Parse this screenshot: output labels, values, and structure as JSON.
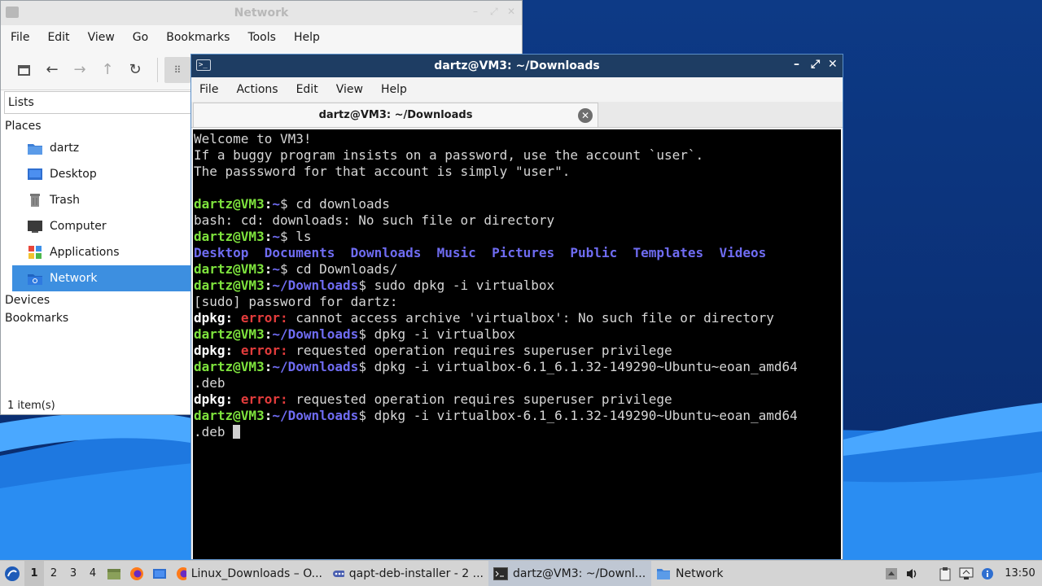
{
  "file_manager": {
    "title": "Network",
    "menu": [
      "File",
      "Edit",
      "View",
      "Go",
      "Bookmarks",
      "Tools",
      "Help"
    ],
    "lists_label": "Lists",
    "places_header": "Places",
    "places": [
      {
        "label": "dartz",
        "icon": "home-folder-icon"
      },
      {
        "label": "Desktop",
        "icon": "desktop-icon"
      },
      {
        "label": "Trash",
        "icon": "trash-icon"
      },
      {
        "label": "Computer",
        "icon": "computer-icon"
      },
      {
        "label": "Applications",
        "icon": "applications-icon"
      },
      {
        "label": "Network",
        "icon": "network-icon",
        "selected": true
      }
    ],
    "devices_header": "Devices",
    "bookmarks_header": "Bookmarks",
    "status": "1 item(s)"
  },
  "terminal": {
    "title": "dartz@VM3: ~/Downloads",
    "menu": [
      "File",
      "Actions",
      "Edit",
      "View",
      "Help"
    ],
    "tab_label": "dartz@VM3: ~/Downloads",
    "lines": [
      [
        {
          "t": "Welcome to VM3!",
          "c": ""
        }
      ],
      [
        {
          "t": "If a buggy program insists on a password, use the account `user`.",
          "c": ""
        }
      ],
      [
        {
          "t": "The passsword for that account is simply \"user\".",
          "c": ""
        }
      ],
      [
        {
          "t": "",
          "c": ""
        }
      ],
      [
        {
          "t": "dartz@VM3",
          "c": "g"
        },
        {
          "t": ":",
          "c": "w"
        },
        {
          "t": "~",
          "c": "b"
        },
        {
          "t": "$ cd downloads",
          "c": ""
        }
      ],
      [
        {
          "t": "bash: cd: downloads: No such file or directory",
          "c": ""
        }
      ],
      [
        {
          "t": "dartz@VM3",
          "c": "g"
        },
        {
          "t": ":",
          "c": "w"
        },
        {
          "t": "~",
          "c": "b"
        },
        {
          "t": "$ ls",
          "c": ""
        }
      ],
      [
        {
          "t": "Desktop",
          "c": "b"
        },
        {
          "t": "  ",
          "c": ""
        },
        {
          "t": "Documents",
          "c": "b"
        },
        {
          "t": "  ",
          "c": ""
        },
        {
          "t": "Downloads",
          "c": "b"
        },
        {
          "t": "  ",
          "c": ""
        },
        {
          "t": "Music",
          "c": "b"
        },
        {
          "t": "  ",
          "c": ""
        },
        {
          "t": "Pictures",
          "c": "b"
        },
        {
          "t": "  ",
          "c": ""
        },
        {
          "t": "Public",
          "c": "b"
        },
        {
          "t": "  ",
          "c": ""
        },
        {
          "t": "Templates",
          "c": "b"
        },
        {
          "t": "  ",
          "c": ""
        },
        {
          "t": "Videos",
          "c": "b"
        }
      ],
      [
        {
          "t": "dartz@VM3",
          "c": "g"
        },
        {
          "t": ":",
          "c": "w"
        },
        {
          "t": "~",
          "c": "b"
        },
        {
          "t": "$ cd Downloads/",
          "c": ""
        }
      ],
      [
        {
          "t": "dartz@VM3",
          "c": "g"
        },
        {
          "t": ":",
          "c": "w"
        },
        {
          "t": "~/Downloads",
          "c": "b"
        },
        {
          "t": "$ sudo dpkg -i virtualbox",
          "c": ""
        }
      ],
      [
        {
          "t": "[sudo] password for dartz:",
          "c": ""
        }
      ],
      [
        {
          "t": "dpkg:",
          "c": "w"
        },
        {
          "t": " ",
          "c": ""
        },
        {
          "t": "error:",
          "c": "r"
        },
        {
          "t": " cannot access archive 'virtualbox': No such file or directory",
          "c": ""
        }
      ],
      [
        {
          "t": "dartz@VM3",
          "c": "g"
        },
        {
          "t": ":",
          "c": "w"
        },
        {
          "t": "~/Downloads",
          "c": "b"
        },
        {
          "t": "$ dpkg -i virtualbox",
          "c": ""
        }
      ],
      [
        {
          "t": "dpkg:",
          "c": "w"
        },
        {
          "t": " ",
          "c": ""
        },
        {
          "t": "error:",
          "c": "r"
        },
        {
          "t": " requested operation requires superuser privilege",
          "c": ""
        }
      ],
      [
        {
          "t": "dartz@VM3",
          "c": "g"
        },
        {
          "t": ":",
          "c": "w"
        },
        {
          "t": "~/Downloads",
          "c": "b"
        },
        {
          "t": "$ dpkg -i virtualbox-6.1_6.1.32-149290~Ubuntu~eoan_amd64",
          "c": ""
        }
      ],
      [
        {
          "t": ".deb",
          "c": ""
        }
      ],
      [
        {
          "t": "dpkg:",
          "c": "w"
        },
        {
          "t": " ",
          "c": ""
        },
        {
          "t": "error:",
          "c": "r"
        },
        {
          "t": " requested operation requires superuser privilege",
          "c": ""
        }
      ],
      [
        {
          "t": "dartz@VM3",
          "c": "g"
        },
        {
          "t": ":",
          "c": "w"
        },
        {
          "t": "~/Downloads",
          "c": "b"
        },
        {
          "t": "$ dpkg -i virtualbox-6.1_6.1.32-149290~Ubuntu~eoan_amd64",
          "c": ""
        }
      ],
      [
        {
          "t": ".deb ",
          "c": ""
        },
        {
          "t": "",
          "c": "cursor"
        }
      ]
    ]
  },
  "taskbar": {
    "workspaces": [
      "1",
      "2",
      "3",
      "4"
    ],
    "current_workspace": "1",
    "tasks": [
      {
        "label": "Linux_Downloads – O...",
        "icon": "firefox-icon"
      },
      {
        "label": "qapt-deb-installer - 2 ...",
        "icon": "installer-icon"
      },
      {
        "label": "dartz@VM3: ~/Downl...",
        "icon": "terminal-icon",
        "active": true
      },
      {
        "label": "Network",
        "icon": "folder-icon"
      }
    ],
    "clock": "13:50"
  },
  "colors": {
    "prompt_user": "#7ee33d",
    "prompt_path": "#6f6cf2",
    "error": "#e43c3c",
    "selection": "#3d8fe0",
    "terminal_titlebar": "#1e3d63"
  }
}
